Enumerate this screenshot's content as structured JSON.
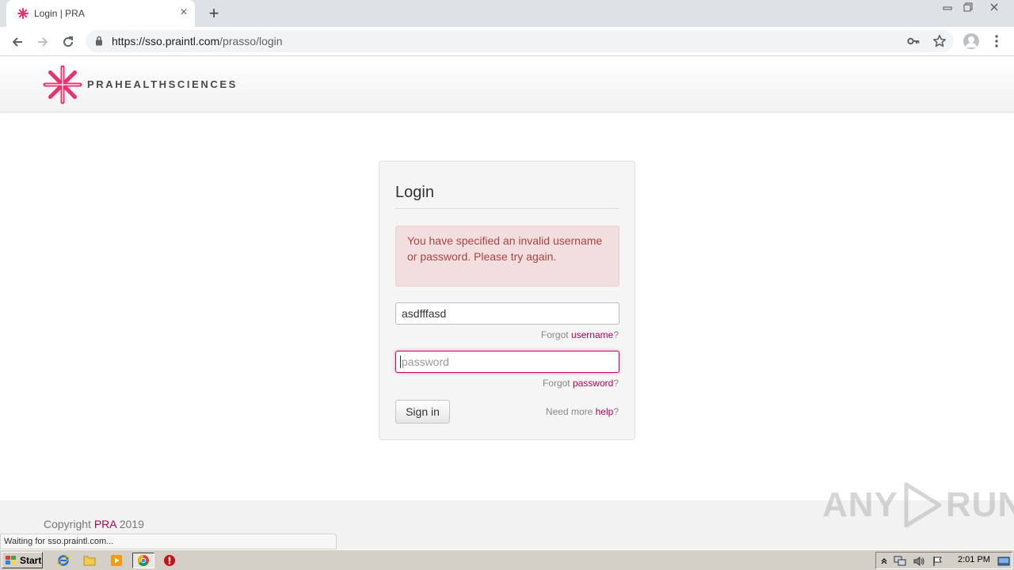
{
  "browser": {
    "tab_title": "Login | PRA",
    "new_tab_symbol": "+",
    "close_tab_symbol": "×",
    "url_host": "https://sso.praintl.com",
    "url_path": "/prasso/login",
    "status_text": "Waiting for sso.praintl.com..."
  },
  "header": {
    "logo_text": "PRAHEALTHSCIENCES",
    "brand_color": "#e8336e"
  },
  "login": {
    "title": "Login",
    "error_message": "You have specified an invalid username or password. Please try again.",
    "username_value": "asdfffasd",
    "password_placeholder": "password",
    "forgot_username_prefix": "Forgot ",
    "forgot_username_link": "username",
    "forgot_username_suffix": "?",
    "forgot_password_prefix": "Forgot ",
    "forgot_password_link": "password",
    "forgot_password_suffix": "?",
    "sign_in_label": "Sign in",
    "need_help_prefix": "Need more ",
    "need_help_link": "help",
    "need_help_suffix": "?"
  },
  "footer": {
    "copyright_prefix": "Copyright ",
    "copyright_link": "PRA",
    "copyright_year": " 2019"
  },
  "watermark": {
    "left_text": "ANY",
    "right_text": "RUN"
  },
  "taskbar": {
    "start_label": "Start",
    "clock": "2:01 PM"
  },
  "colors": {
    "link": "#b30059",
    "alert_bg": "#f2dede",
    "alert_text": "#a94442",
    "focus_border": "#cc0066"
  }
}
